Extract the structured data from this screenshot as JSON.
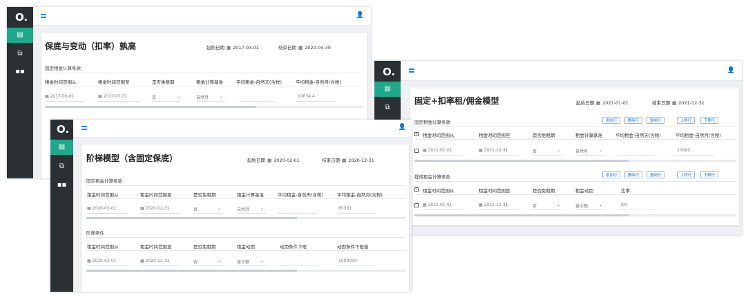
{
  "window1": {
    "title": "保底与变动（扣率）孰高",
    "start_label": "起始日期",
    "start_date": "2017-03-01",
    "end_label": "结束日期",
    "end_date": "2020-04-30",
    "section_fixed": "固定租金计算条款",
    "headers": [
      "租金时间范围从",
      "租金时间范围至",
      "是否免租期",
      "租金计算基准",
      "平均租金-自然天(含税)",
      "平均租金-自然月(含税)"
    ],
    "row": {
      "from": "2017-03-01",
      "to": "2017-07-31",
      "free": "是",
      "basis": "自然月",
      "avg_day": "",
      "avg_month": "10634.4"
    }
  },
  "window2": {
    "title": "阶梯模型（含固定保底）",
    "start_label": "起始日期",
    "start_date": "2020-02-01",
    "end_label": "结束日期",
    "end_date": "2020-12-31",
    "section_fixed": "固定租金计算条款",
    "headers": [
      "租金时间范围从",
      "租金时间范围至",
      "是否免租期",
      "租金计算基准",
      "平均租金-自然天(含税)",
      "平均租金-自然月(含税)"
    ],
    "row": {
      "from": "2020-02-01",
      "to": "2020-12-31",
      "free": "否",
      "basis": "自然月",
      "avg_day": "",
      "avg_month": "85301"
    },
    "section_ladder": "阶梯条件",
    "ladder_headers": [
      "租金时间范围从",
      "租金时间范围至",
      "是否免租期",
      "租金动因",
      "动因条件下限",
      "动因条件下限值"
    ],
    "ladder_row": {
      "from": "2020-02-01",
      "to": "2020-12-31",
      "free": "否",
      "driver": "营业额",
      "lower": "",
      "lower_value": "1000000"
    }
  },
  "window3": {
    "title": "固定+扣率租/佣金模型",
    "start_label": "起始日期",
    "start_date": "2021-01-01",
    "end_label": "结束日期",
    "end_date": "2021-12-31",
    "section_fixed": "固定租金计算条款",
    "buttons": [
      "添加行",
      "删除行",
      "复制行",
      "上移行",
      "下移行"
    ],
    "headers": [
      "租金时间范围从",
      "租金时间范围至",
      "是否免租期",
      "租金计算基准",
      "平均租金-自然天(含税)",
      "平均租金-自然月(含税)"
    ],
    "row": {
      "from": "2021-01-01",
      "to": "2021-12-31",
      "free": "否",
      "basis": "自然月",
      "avg_day": "",
      "avg_month": "10000"
    },
    "section_comm": "提成租金计算条款",
    "comm_headers": [
      "租金时间范围从",
      "租金时间范围至",
      "是否免租期",
      "租金动因",
      "比率"
    ],
    "comm_row": {
      "from": "2021-01-01",
      "to": "2021-12-31",
      "free": "否",
      "driver": "营业额",
      "rate": "8%"
    }
  },
  "icons": {
    "logo": "logo-ring-icon",
    "calendar": "calendar-icon",
    "menu": "menu-icon",
    "user": "user-icon"
  },
  "colors": {
    "sidebar": "#2b3035",
    "accent": "#20a88c",
    "link": "#1e88e5"
  }
}
